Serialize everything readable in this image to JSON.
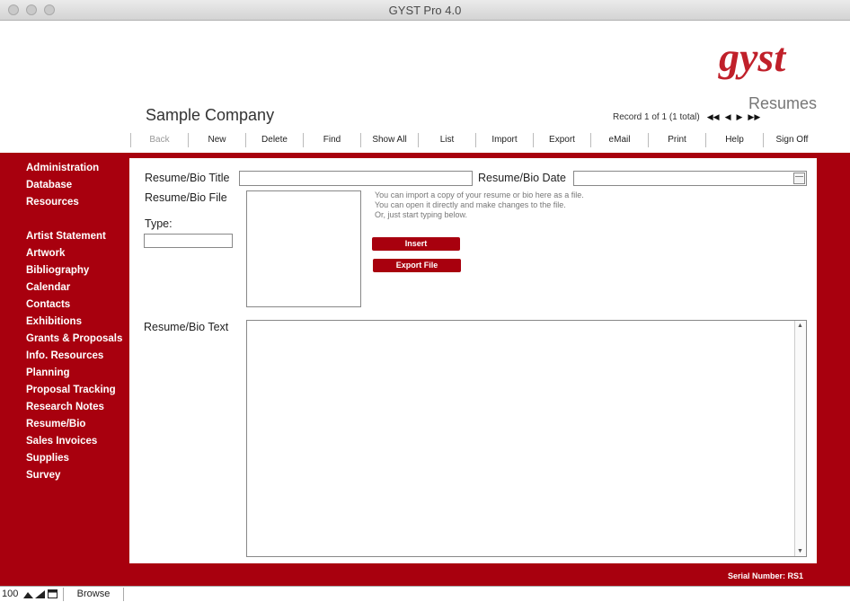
{
  "window": {
    "title": "GYST Pro 4.0"
  },
  "header": {
    "logo_text": "gyst",
    "company": "Sample Company",
    "module": "Resumes",
    "record_status": "Record 1 of 1 (1 total)"
  },
  "toolbar": [
    {
      "label": "Back",
      "disabled": true
    },
    {
      "label": "New"
    },
    {
      "label": "Delete"
    },
    {
      "label": "Find"
    },
    {
      "label": "Show All"
    },
    {
      "label": "List"
    },
    {
      "label": "Import"
    },
    {
      "label": "Export"
    },
    {
      "label": "eMail"
    },
    {
      "label": "Print"
    },
    {
      "label": "Help"
    },
    {
      "label": "Sign Off"
    }
  ],
  "sidebar": {
    "top": [
      "Administration",
      "Database",
      "Resources"
    ],
    "modules": [
      "Artist Statement",
      "Artwork",
      "Bibliography",
      "Calendar",
      "Contacts",
      "Exhibitions",
      "Grants & Proposals",
      "Info. Resources",
      "Planning",
      "Proposal Tracking",
      "Research Notes",
      "Resume/Bio",
      "Sales Invoices",
      "Supplies",
      "Survey"
    ],
    "active": [
      "Database",
      "Resume/Bio"
    ]
  },
  "form": {
    "title_label": "Resume/Bio Title",
    "title_value": "",
    "date_label": "Resume/Bio Date",
    "date_value": "",
    "file_label": "Resume/Bio File",
    "type_label": "Type:",
    "type_value": "",
    "hint1": "You can import a copy of your resume or bio here as a file.",
    "hint2": "You can open it directly and make changes to the file.",
    "hint3": "Or, just start typing below.",
    "insert_button": "Insert",
    "export_button": "Export File",
    "text_label": "Resume/Bio Text",
    "text_value": ""
  },
  "footer": {
    "serial": "Serial Number: RS1"
  },
  "status": {
    "zoom": "100",
    "mode": "Browse"
  },
  "colors": {
    "brand_red": "#a8000e",
    "logo_red": "#c0202a"
  }
}
